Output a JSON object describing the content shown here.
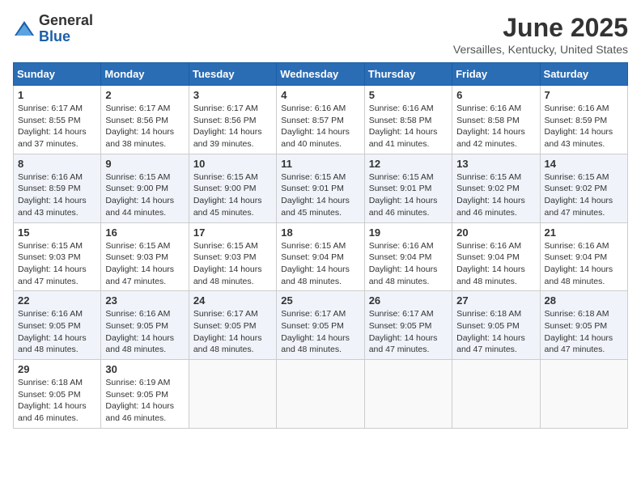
{
  "logo": {
    "general": "General",
    "blue": "Blue"
  },
  "title": "June 2025",
  "location": "Versailles, Kentucky, United States",
  "headers": [
    "Sunday",
    "Monday",
    "Tuesday",
    "Wednesday",
    "Thursday",
    "Friday",
    "Saturday"
  ],
  "weeks": [
    [
      {
        "day": "1",
        "sunrise": "6:17 AM",
        "sunset": "8:55 PM",
        "daylight": "14 hours and 37 minutes."
      },
      {
        "day": "2",
        "sunrise": "6:17 AM",
        "sunset": "8:56 PM",
        "daylight": "14 hours and 38 minutes."
      },
      {
        "day": "3",
        "sunrise": "6:17 AM",
        "sunset": "8:56 PM",
        "daylight": "14 hours and 39 minutes."
      },
      {
        "day": "4",
        "sunrise": "6:16 AM",
        "sunset": "8:57 PM",
        "daylight": "14 hours and 40 minutes."
      },
      {
        "day": "5",
        "sunrise": "6:16 AM",
        "sunset": "8:58 PM",
        "daylight": "14 hours and 41 minutes."
      },
      {
        "day": "6",
        "sunrise": "6:16 AM",
        "sunset": "8:58 PM",
        "daylight": "14 hours and 42 minutes."
      },
      {
        "day": "7",
        "sunrise": "6:16 AM",
        "sunset": "8:59 PM",
        "daylight": "14 hours and 43 minutes."
      }
    ],
    [
      {
        "day": "8",
        "sunrise": "6:16 AM",
        "sunset": "8:59 PM",
        "daylight": "14 hours and 43 minutes."
      },
      {
        "day": "9",
        "sunrise": "6:15 AM",
        "sunset": "9:00 PM",
        "daylight": "14 hours and 44 minutes."
      },
      {
        "day": "10",
        "sunrise": "6:15 AM",
        "sunset": "9:00 PM",
        "daylight": "14 hours and 45 minutes."
      },
      {
        "day": "11",
        "sunrise": "6:15 AM",
        "sunset": "9:01 PM",
        "daylight": "14 hours and 45 minutes."
      },
      {
        "day": "12",
        "sunrise": "6:15 AM",
        "sunset": "9:01 PM",
        "daylight": "14 hours and 46 minutes."
      },
      {
        "day": "13",
        "sunrise": "6:15 AM",
        "sunset": "9:02 PM",
        "daylight": "14 hours and 46 minutes."
      },
      {
        "day": "14",
        "sunrise": "6:15 AM",
        "sunset": "9:02 PM",
        "daylight": "14 hours and 47 minutes."
      }
    ],
    [
      {
        "day": "15",
        "sunrise": "6:15 AM",
        "sunset": "9:03 PM",
        "daylight": "14 hours and 47 minutes."
      },
      {
        "day": "16",
        "sunrise": "6:15 AM",
        "sunset": "9:03 PM",
        "daylight": "14 hours and 47 minutes."
      },
      {
        "day": "17",
        "sunrise": "6:15 AM",
        "sunset": "9:03 PM",
        "daylight": "14 hours and 48 minutes."
      },
      {
        "day": "18",
        "sunrise": "6:15 AM",
        "sunset": "9:04 PM",
        "daylight": "14 hours and 48 minutes."
      },
      {
        "day": "19",
        "sunrise": "6:16 AM",
        "sunset": "9:04 PM",
        "daylight": "14 hours and 48 minutes."
      },
      {
        "day": "20",
        "sunrise": "6:16 AM",
        "sunset": "9:04 PM",
        "daylight": "14 hours and 48 minutes."
      },
      {
        "day": "21",
        "sunrise": "6:16 AM",
        "sunset": "9:04 PM",
        "daylight": "14 hours and 48 minutes."
      }
    ],
    [
      {
        "day": "22",
        "sunrise": "6:16 AM",
        "sunset": "9:05 PM",
        "daylight": "14 hours and 48 minutes."
      },
      {
        "day": "23",
        "sunrise": "6:16 AM",
        "sunset": "9:05 PM",
        "daylight": "14 hours and 48 minutes."
      },
      {
        "day": "24",
        "sunrise": "6:17 AM",
        "sunset": "9:05 PM",
        "daylight": "14 hours and 48 minutes."
      },
      {
        "day": "25",
        "sunrise": "6:17 AM",
        "sunset": "9:05 PM",
        "daylight": "14 hours and 48 minutes."
      },
      {
        "day": "26",
        "sunrise": "6:17 AM",
        "sunset": "9:05 PM",
        "daylight": "14 hours and 47 minutes."
      },
      {
        "day": "27",
        "sunrise": "6:18 AM",
        "sunset": "9:05 PM",
        "daylight": "14 hours and 47 minutes."
      },
      {
        "day": "28",
        "sunrise": "6:18 AM",
        "sunset": "9:05 PM",
        "daylight": "14 hours and 47 minutes."
      }
    ],
    [
      {
        "day": "29",
        "sunrise": "6:18 AM",
        "sunset": "9:05 PM",
        "daylight": "14 hours and 46 minutes."
      },
      {
        "day": "30",
        "sunrise": "6:19 AM",
        "sunset": "9:05 PM",
        "daylight": "14 hours and 46 minutes."
      },
      null,
      null,
      null,
      null,
      null
    ]
  ]
}
